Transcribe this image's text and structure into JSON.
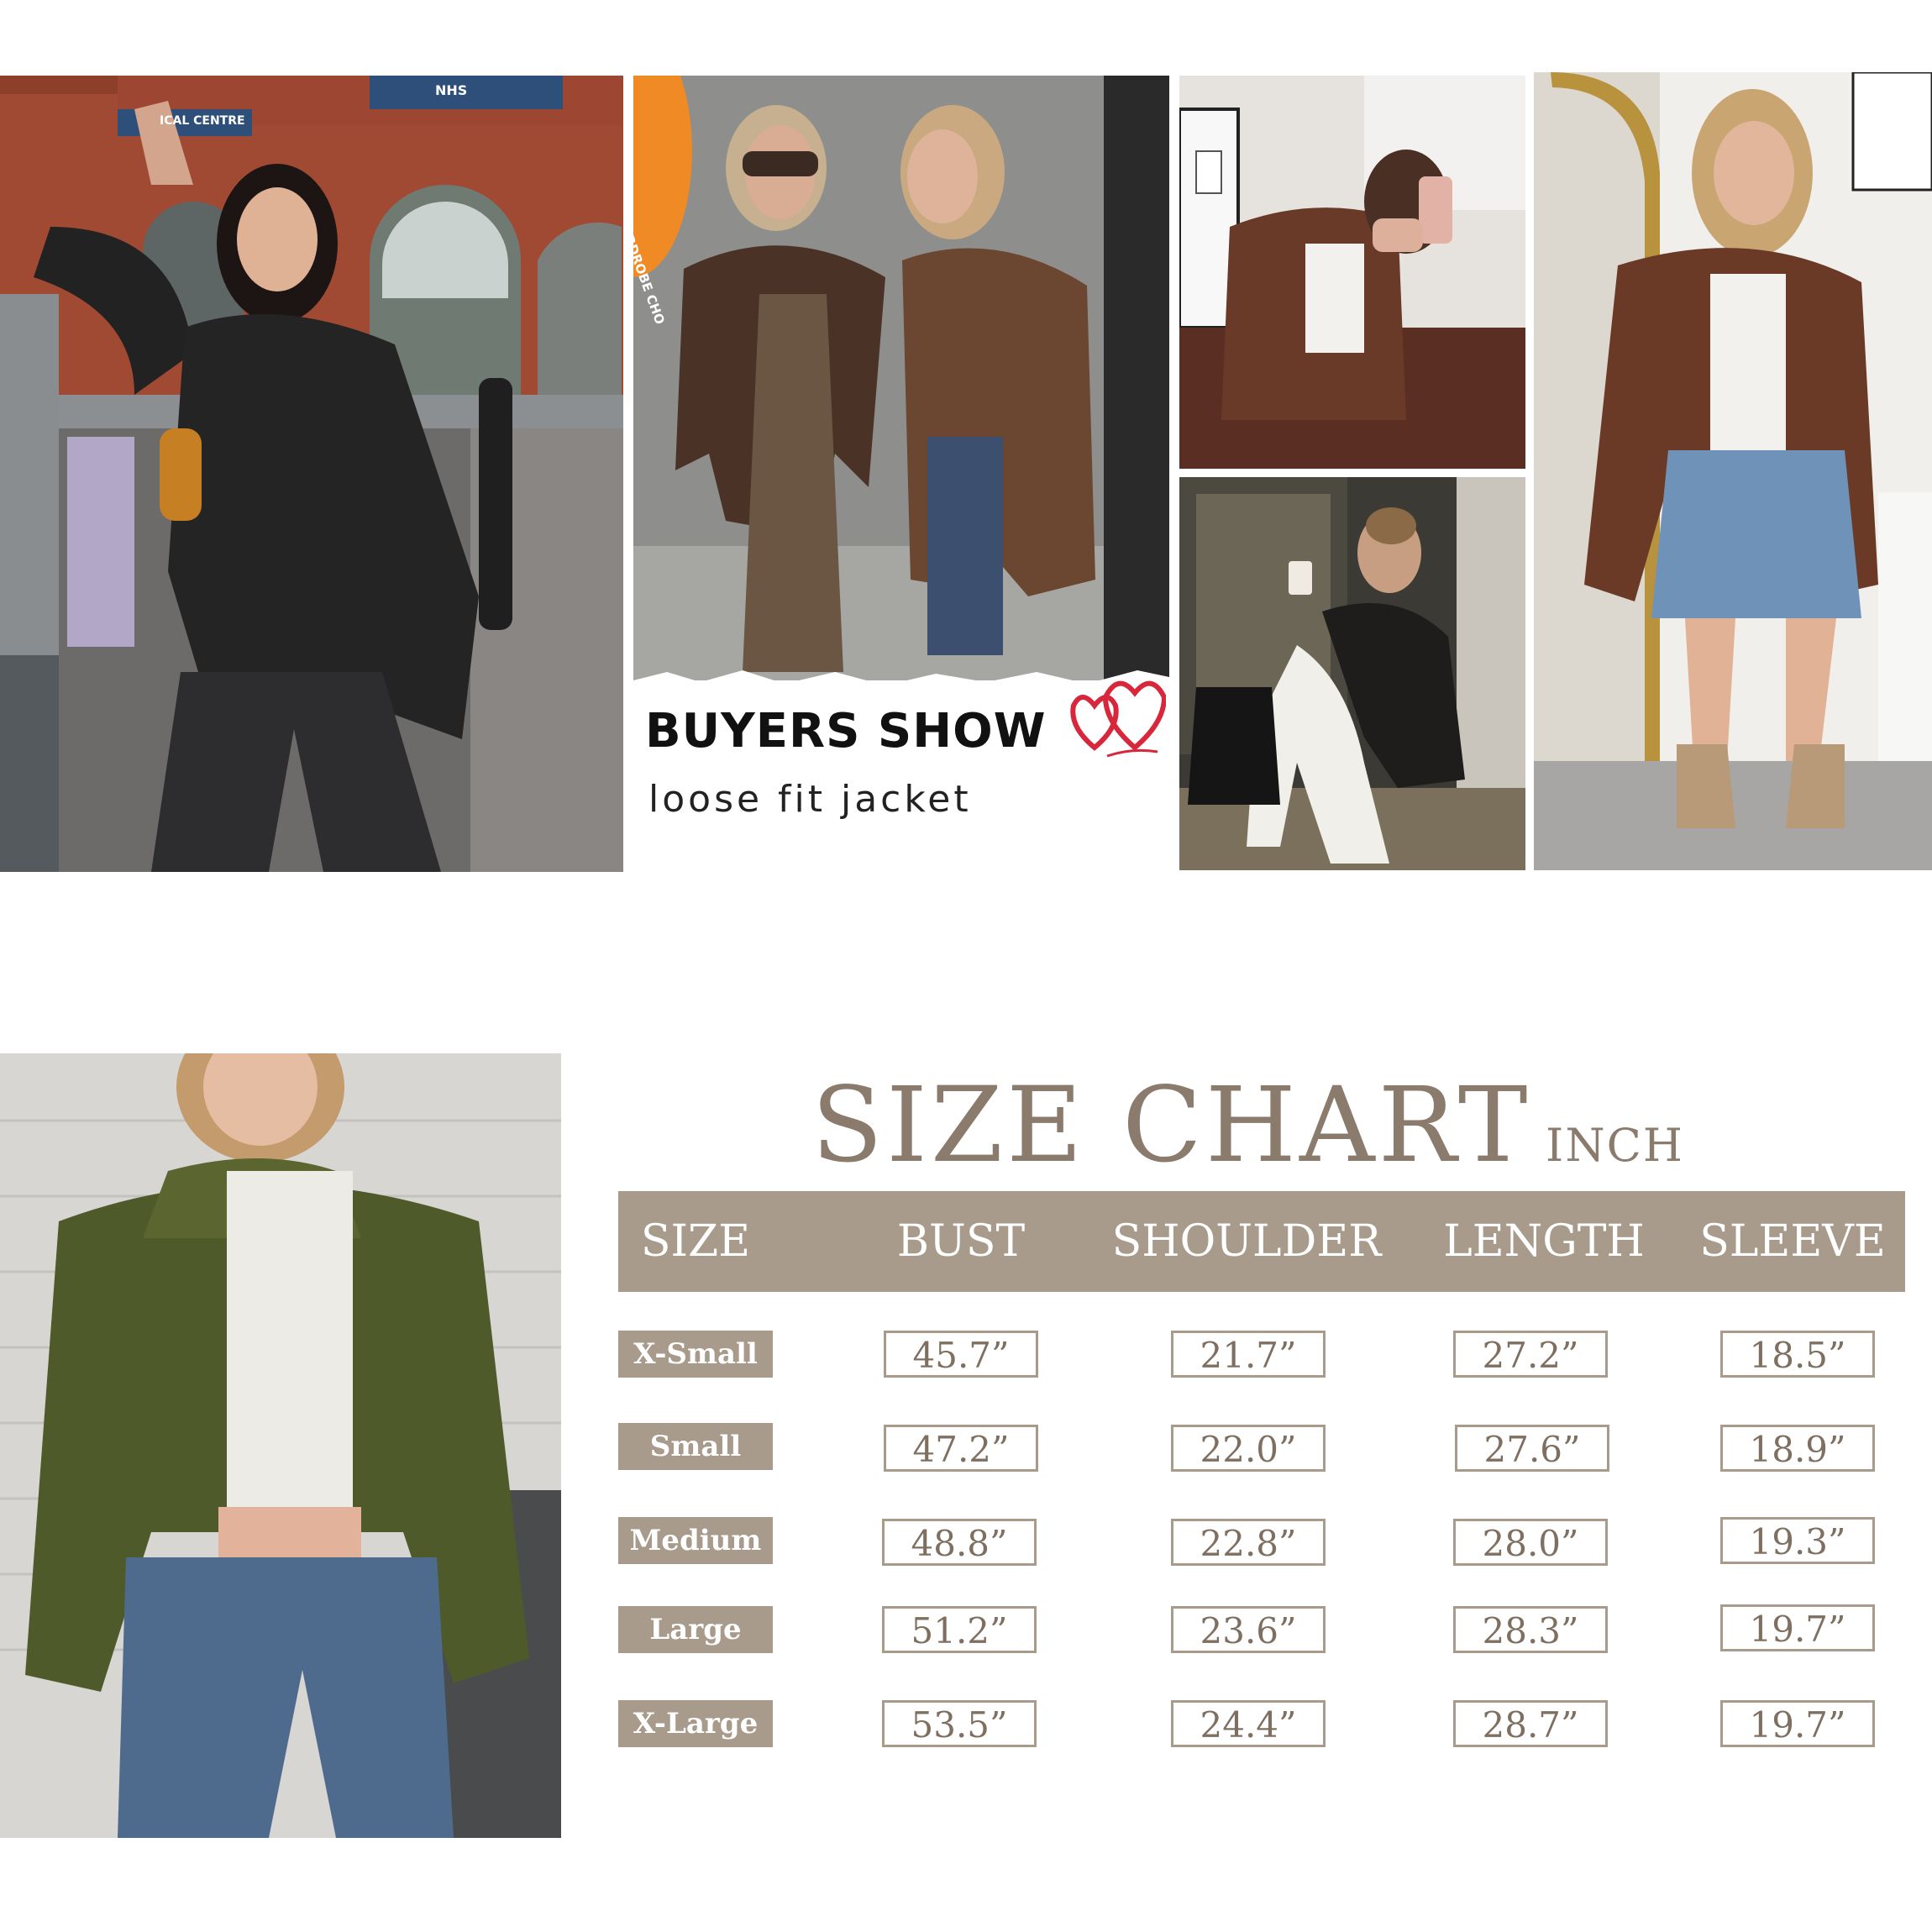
{
  "buyers_show": {
    "title": "BUYERS SHOW",
    "subtitle": "loose fit jacket",
    "badge_text": "FALL WARDROBE CHO"
  },
  "photo_left_signs": {
    "sign1": "NHS",
    "sign2": "ICAL CENTRE"
  },
  "size_chart": {
    "title": "SIZE CHART",
    "unit": "INCH",
    "columns": [
      "SIZE",
      "BUST",
      "SHOULDER",
      "LENGTH",
      "SLEEVE"
    ],
    "rows": [
      {
        "size": "X-Small",
        "values": [
          "45.7”",
          "21.7”",
          "27.2”",
          "18.5”"
        ]
      },
      {
        "size": "Small",
        "values": [
          "47.2”",
          "22.0”",
          "27.6”",
          "18.9”"
        ]
      },
      {
        "size": "Medium",
        "values": [
          "48.8”",
          "22.8”",
          "28.0”",
          "19.3”"
        ]
      },
      {
        "size": "Large",
        "values": [
          "51.2”",
          "23.6”",
          "28.3”",
          "19.7”"
        ]
      },
      {
        "size": "X-Large",
        "values": [
          "53.5”",
          "24.4”",
          "28.7”",
          "19.7”"
        ]
      }
    ]
  },
  "colors": {
    "accent": "#a89b8b",
    "title_text": "#8a7b6c",
    "value_text": "#7e6f60",
    "badge": "#f08a24",
    "heart": "#d8263a"
  }
}
